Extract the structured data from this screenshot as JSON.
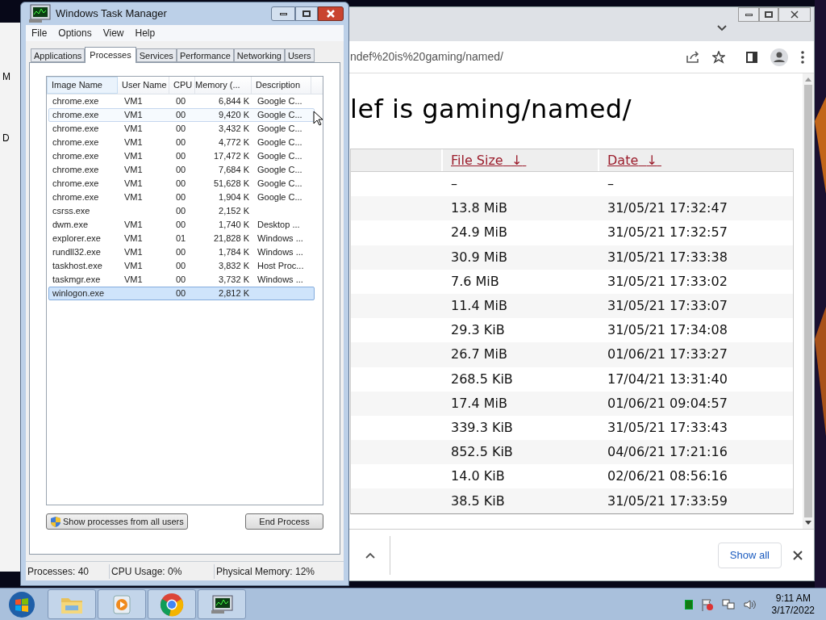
{
  "desktop": {
    "fragments": [
      "M",
      "D"
    ]
  },
  "browser": {
    "url": "ndef%20is%20gaming/named/",
    "heading": "lef is gaming/named/",
    "table": {
      "columns": [
        {
          "label": "File Size",
          "sort": "↓"
        },
        {
          "label": "Date",
          "sort": "↓"
        }
      ],
      "rows": [
        [
          "–",
          "–"
        ],
        [
          "13.8 MiB",
          "31/05/21 17:32:47"
        ],
        [
          "24.9 MiB",
          "31/05/21 17:32:57"
        ],
        [
          "30.9 MiB",
          "31/05/21 17:33:38"
        ],
        [
          "7.6 MiB",
          "31/05/21 17:33:02"
        ],
        [
          "11.4 MiB",
          "31/05/21 17:33:07"
        ],
        [
          "29.3 KiB",
          "31/05/21 17:34:08"
        ],
        [
          "26.7 MiB",
          "01/06/21 17:33:27"
        ],
        [
          "268.5 KiB",
          "17/04/21 13:31:40"
        ],
        [
          "17.4 MiB",
          "01/06/21 09:04:57"
        ],
        [
          "339.3 KiB",
          "31/05/21 17:33:43"
        ],
        [
          "852.5 KiB",
          "04/06/21 17:21:16"
        ],
        [
          "14.0 KiB",
          "02/06/21 08:56:16"
        ],
        [
          "38.5 KiB",
          "31/05/21 17:33:59"
        ]
      ]
    },
    "download_bar": {
      "button": "Show all"
    }
  },
  "task_manager": {
    "title": "Windows Task Manager",
    "menu": [
      "File",
      "Options",
      "View",
      "Help"
    ],
    "tabs": [
      {
        "label": "Applications",
        "selected": false
      },
      {
        "label": "Processes",
        "selected": true
      },
      {
        "label": "Services",
        "selected": false
      },
      {
        "label": "Performance",
        "selected": false
      },
      {
        "label": "Networking",
        "selected": false
      },
      {
        "label": "Users",
        "selected": false
      }
    ],
    "columns": [
      "Image Name",
      "User Name",
      "CPU",
      "Memory (...",
      "Description"
    ],
    "rows": [
      {
        "name": "chrome.exe",
        "user": "VM1",
        "cpu": "00",
        "memory": "6,844 K",
        "description": "Google C...",
        "selected": false,
        "hovered": false
      },
      {
        "name": "chrome.exe",
        "user": "VM1",
        "cpu": "00",
        "memory": "9,420 K",
        "description": "Google C...",
        "selected": false,
        "hovered": true
      },
      {
        "name": "chrome.exe",
        "user": "VM1",
        "cpu": "00",
        "memory": "3,432 K",
        "description": "Google C...",
        "selected": false,
        "hovered": false
      },
      {
        "name": "chrome.exe",
        "user": "VM1",
        "cpu": "00",
        "memory": "4,772 K",
        "description": "Google C...",
        "selected": false,
        "hovered": false
      },
      {
        "name": "chrome.exe",
        "user": "VM1",
        "cpu": "00",
        "memory": "17,472 K",
        "description": "Google C...",
        "selected": false,
        "hovered": false
      },
      {
        "name": "chrome.exe",
        "user": "VM1",
        "cpu": "00",
        "memory": "7,684 K",
        "description": "Google C...",
        "selected": false,
        "hovered": false
      },
      {
        "name": "chrome.exe",
        "user": "VM1",
        "cpu": "00",
        "memory": "51,628 K",
        "description": "Google C...",
        "selected": false,
        "hovered": false
      },
      {
        "name": "chrome.exe",
        "user": "VM1",
        "cpu": "00",
        "memory": "1,904 K",
        "description": "Google C...",
        "selected": false,
        "hovered": false
      },
      {
        "name": "csrss.exe",
        "cpu": "00",
        "memory": "2,152 K",
        "selected": false,
        "hovered": false
      },
      {
        "name": "dwm.exe",
        "user": "VM1",
        "cpu": "00",
        "memory": "1,740 K",
        "description": "Desktop ...",
        "selected": false,
        "hovered": false
      },
      {
        "name": "explorer.exe",
        "user": "VM1",
        "cpu": "01",
        "memory": "21,828 K",
        "description": "Windows ...",
        "selected": false,
        "hovered": false
      },
      {
        "name": "rundll32.exe",
        "user": "VM1",
        "cpu": "00",
        "memory": "1,784 K",
        "description": "Windows ...",
        "selected": false,
        "hovered": false
      },
      {
        "name": "taskhost.exe",
        "user": "VM1",
        "cpu": "00",
        "memory": "3,832 K",
        "description": "Host Proc...",
        "selected": false,
        "hovered": false
      },
      {
        "name": "taskmgr.exe",
        "user": "VM1",
        "cpu": "00",
        "memory": "3,732 K",
        "description": "Windows ...",
        "selected": false,
        "hovered": false
      },
      {
        "name": "winlogon.exe",
        "cpu": "00",
        "memory": "2,812 K",
        "selected": true,
        "hovered": false
      }
    ],
    "buttons": {
      "show_all": "Show processes from all users",
      "end": "End Process"
    },
    "status": [
      "Processes: 40",
      "CPU Usage: 0%",
      "Physical Memory: 12%"
    ]
  },
  "taskbar": {
    "apps": [
      {
        "kind": "folder"
      },
      {
        "kind": "media"
      },
      {
        "kind": "chrome"
      },
      {
        "kind": "monitor"
      }
    ],
    "time": "9:11 AM",
    "date": "3/17/2022"
  }
}
